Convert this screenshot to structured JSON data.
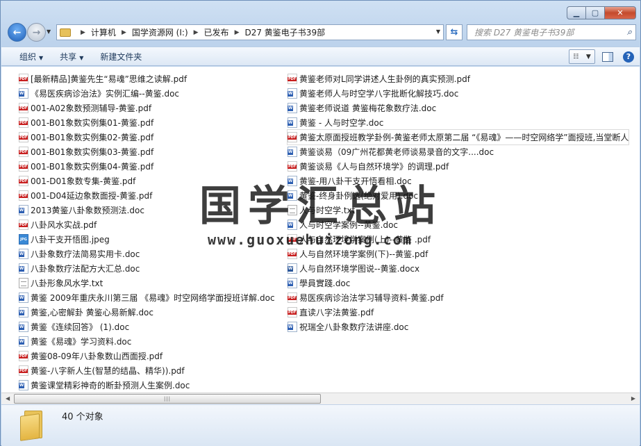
{
  "address": {
    "crumbs": [
      "计算机",
      "国学资源网 (I:)",
      "已发布",
      "D27 黄鉴电子书39部"
    ]
  },
  "search": {
    "placeholder": "搜索 D27 黄鉴电子书39部"
  },
  "toolbar": {
    "organize": "组织",
    "share": "共享",
    "new_folder": "新建文件夹"
  },
  "files_left": [
    {
      "type": "pdf",
      "name": "[最新精品]黄鉴先生“易魂”思维之读解.pdf"
    },
    {
      "type": "doc",
      "name": "《易医疾病诊治法》实例汇编--黄鉴.doc"
    },
    {
      "type": "pdf",
      "name": "001-A02象数预测辅导-黄鉴.pdf"
    },
    {
      "type": "pdf",
      "name": "001-B01象数实例集01-黄鉴.pdf"
    },
    {
      "type": "pdf",
      "name": "001-B01象数实例集02-黄鉴.pdf"
    },
    {
      "type": "pdf",
      "name": "001-B01象数实例集03-黄鉴.pdf"
    },
    {
      "type": "pdf",
      "name": "001-B01象数实例集04-黄鉴.pdf"
    },
    {
      "type": "pdf",
      "name": "001-D01象数专集-黄鉴.pdf"
    },
    {
      "type": "pdf",
      "name": "001-D04延边象数面授-黄鉴.pdf"
    },
    {
      "type": "doc",
      "name": "2013黄鉴八卦象数预测法.doc"
    },
    {
      "type": "pdf",
      "name": "八卦风水实战.pdf"
    },
    {
      "type": "jpg",
      "name": "八卦干支开悟图.jpeg"
    },
    {
      "type": "doc",
      "name": "八卦象数疗法简易实用卡.doc"
    },
    {
      "type": "doc",
      "name": "八卦象数疗法配方大汇总.doc"
    },
    {
      "type": "txt",
      "name": "八卦形象风水学.txt"
    },
    {
      "type": "doc",
      "name": "黄鉴 2009年重庆永川第三届 《易魂》时空网络学面授班详解.doc"
    },
    {
      "type": "doc",
      "name": "黄鉴,心密解卦 黄鉴心易新解.doc"
    },
    {
      "type": "doc",
      "name": "黄鉴《连续回答》 (1).doc"
    },
    {
      "type": "doc",
      "name": "黄鉴《易魂》学习资料.doc"
    },
    {
      "type": "pdf",
      "name": "黄鉴08-09年八卦象数山西面授.pdf"
    },
    {
      "type": "pdf",
      "name": "黄鉴-八字新人生(智慧的结晶、精华)).pdf"
    },
    {
      "type": "doc",
      "name": "黄鉴课堂精彩神奇的断卦预测人生案例.doc"
    }
  ],
  "files_right": [
    {
      "type": "pdf",
      "name": "黄鉴老师对L同学讲述人生卦例的真实预测.pdf"
    },
    {
      "type": "doc",
      "name": "黄鉴老师人与时空学八字批断化解技巧.doc"
    },
    {
      "type": "doc",
      "name": "黄鉴老师说道 黄鉴梅花象数疗法.doc"
    },
    {
      "type": "doc",
      "name": "黄鉴 - 人与时空学.doc"
    },
    {
      "type": "pdf",
      "name": "黄鉴太原面授班教学卦例-黄鉴老师太原第二届 “《易魂》——时空网络学”面授班,当堂断人"
    },
    {
      "type": "doc",
      "name": "黄鉴谈易（09广州花都黄老师谈易录音的文字....doc"
    },
    {
      "type": "pdf",
      "name": "黄鉴谈易《人与自然环境学》的调理.pdf"
    },
    {
      "type": "doc",
      "name": "黄鉴-用八卦干支开悟看相.doc"
    },
    {
      "type": "doc",
      "name": "黄鉴-终身卦例选(绝对爱用).doc"
    },
    {
      "type": "txt",
      "name": "人与时空学.txt"
    },
    {
      "type": "doc",
      "name": "人与时空学案例--黄鉴.doc"
    },
    {
      "type": "pdf",
      "name": "人与自然环境学案例(上)--黄鉴 .pdf"
    },
    {
      "type": "pdf",
      "name": "人与自然环境学案例(下)--黄鉴.pdf"
    },
    {
      "type": "docx",
      "name": "人与自然环境学图说--黄鉴.docx"
    },
    {
      "type": "doc",
      "name": "學員實踐.doc"
    },
    {
      "type": "pdf",
      "name": "易医疾病诊治法学习辅导资料-黄鉴.pdf"
    },
    {
      "type": "pdf",
      "name": "直读八字法黄鉴.pdf"
    },
    {
      "type": "doc",
      "name": "祝瑞全八卦象数疗法讲座.doc"
    }
  ],
  "watermark": {
    "title": "国学汇总站",
    "url": "www.guoxuehuizong.com"
  },
  "status": {
    "count": "40 个对象"
  },
  "colors": {
    "accent": "#2563b8",
    "pdf_red": "#c81e1e",
    "close_red": "#c44a2c"
  }
}
